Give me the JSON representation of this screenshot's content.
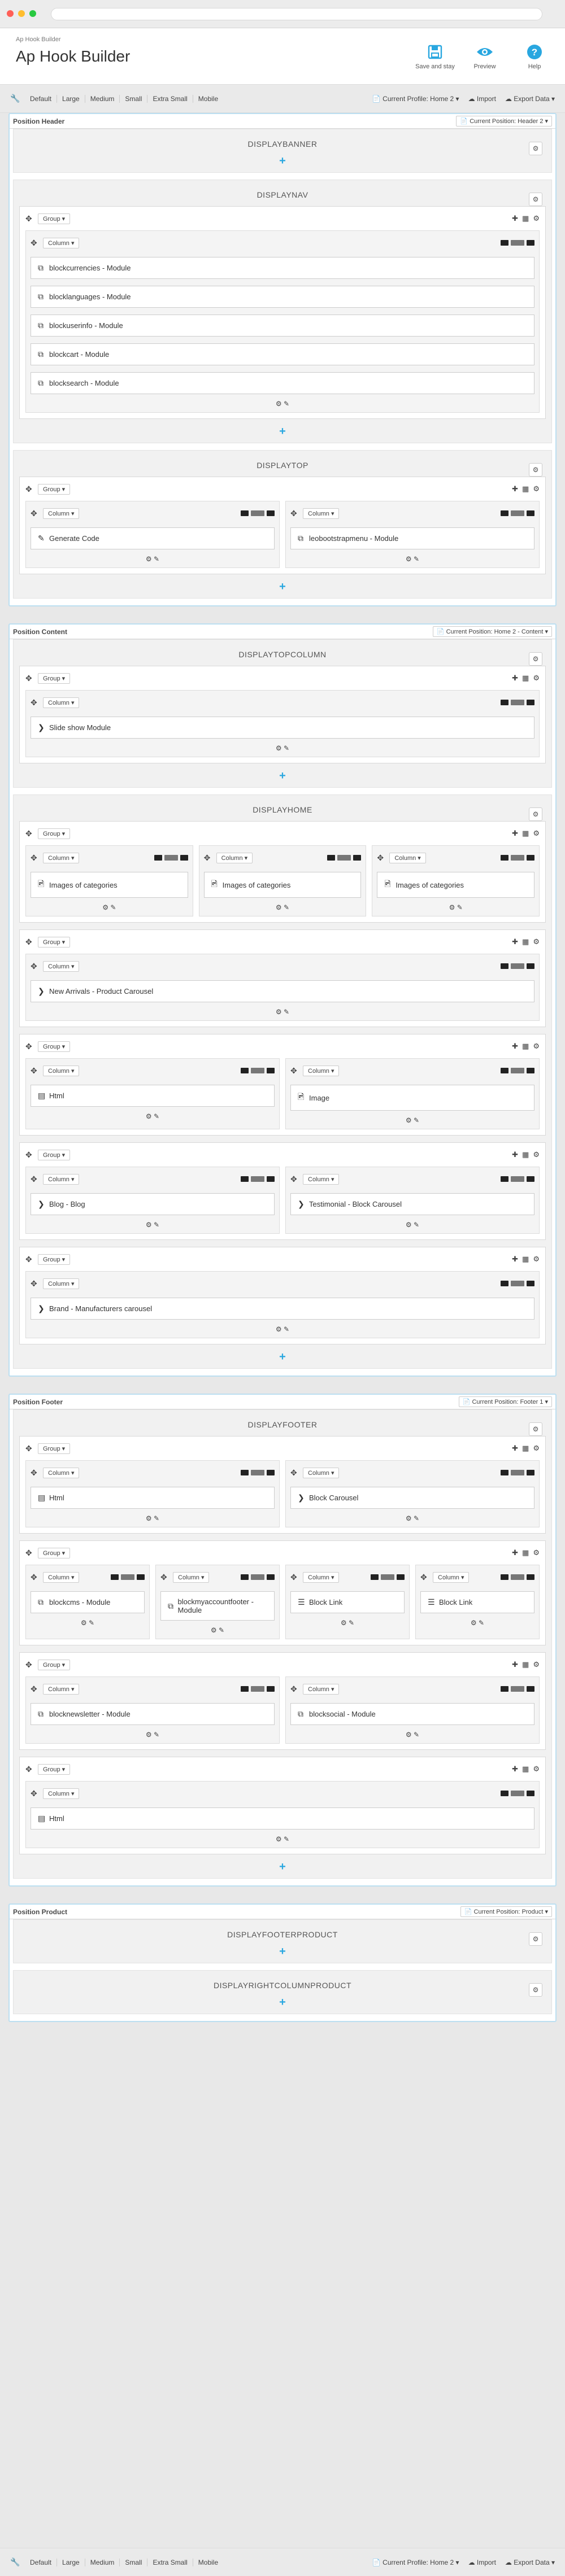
{
  "header": {
    "breadcrumb": "Ap Hook Builder",
    "title": "Ap Hook Builder",
    "save_label": "Save and stay",
    "preview_label": "Preview",
    "help_label": "Help"
  },
  "toolbar": {
    "items": [
      "Default",
      "Large",
      "Medium",
      "Small",
      "Extra Small",
      "Mobile"
    ],
    "profile": "Current Profile: Home 2",
    "import": "Import",
    "export": "Export Data"
  },
  "positions": [
    {
      "title": "Position Header",
      "select": "Current Position: Header 2",
      "hooks": [
        {
          "name": "DISPLAYBANNER",
          "groups": []
        },
        {
          "name": "DISPLAYNAV",
          "groups": [
            {
              "columns": [
                {
                  "modules": [
                    "blockcurrencies - Module",
                    "blocklanguages - Module",
                    "blockuserinfo - Module",
                    "blockcart - Module",
                    "blocksearch - Module"
                  ]
                }
              ]
            }
          ]
        },
        {
          "name": "DISPLAYTOP",
          "groups": [
            {
              "columns": [
                {
                  "modules": [
                    "Generate Code"
                  ]
                },
                {
                  "modules": [
                    "leobootstrapmenu - Module"
                  ]
                }
              ]
            }
          ]
        }
      ]
    },
    {
      "title": "Position Content",
      "select": "Current Position: Home 2 - Content",
      "hooks": [
        {
          "name": "DISPLAYTOPCOLUMN",
          "groups": [
            {
              "columns": [
                {
                  "modules": [
                    "Slide show Module"
                  ]
                }
              ]
            }
          ]
        },
        {
          "name": "DISPLAYHOME",
          "groups": [
            {
              "columns": [
                {
                  "modules": [
                    "Images of categories"
                  ]
                },
                {
                  "modules": [
                    "Images of categories"
                  ]
                },
                {
                  "modules": [
                    "Images of categories"
                  ]
                }
              ]
            },
            {
              "columns": [
                {
                  "modules": [
                    "New Arrivals - Product Carousel"
                  ]
                }
              ]
            },
            {
              "columns": [
                {
                  "modules": [
                    "Html"
                  ]
                },
                {
                  "modules": [
                    "Image"
                  ]
                }
              ]
            },
            {
              "columns": [
                {
                  "modules": [
                    "Blog - Blog"
                  ]
                },
                {
                  "modules": [
                    "Testimonial - Block Carousel"
                  ]
                }
              ]
            },
            {
              "columns": [
                {
                  "modules": [
                    "Brand - Manufacturers carousel"
                  ]
                }
              ]
            }
          ]
        }
      ]
    },
    {
      "title": "Position Footer",
      "select": "Current Position: Footer 1",
      "hooks": [
        {
          "name": "DISPLAYFOOTER",
          "groups": [
            {
              "columns": [
                {
                  "modules": [
                    "Html"
                  ]
                },
                {
                  "modules": [
                    "Block Carousel"
                  ]
                }
              ]
            },
            {
              "columns": [
                {
                  "modules": [
                    "blockcms - Module"
                  ]
                },
                {
                  "modules": [
                    "blockmyaccountfooter - Module"
                  ]
                },
                {
                  "modules": [
                    "Block Link"
                  ]
                },
                {
                  "modules": [
                    "Block Link"
                  ]
                }
              ]
            },
            {
              "columns": [
                {
                  "modules": [
                    "blocknewsletter - Module"
                  ]
                },
                {
                  "modules": [
                    "blocksocial - Module"
                  ]
                }
              ]
            },
            {
              "columns": [
                {
                  "modules": [
                    "Html"
                  ]
                }
              ]
            }
          ]
        }
      ]
    },
    {
      "title": "Position Product",
      "select": "Current Position: Product",
      "hooks": [
        {
          "name": "DISPLAYFOOTERPRODUCT",
          "groups": []
        },
        {
          "name": "DISPLAYRIGHTCOLUMNPRODUCT",
          "groups": []
        }
      ]
    }
  ],
  "labels": {
    "group": "Group",
    "column": "Column"
  },
  "colors": {
    "accent": "#29a7e0",
    "position_border": "#bcdff1"
  }
}
